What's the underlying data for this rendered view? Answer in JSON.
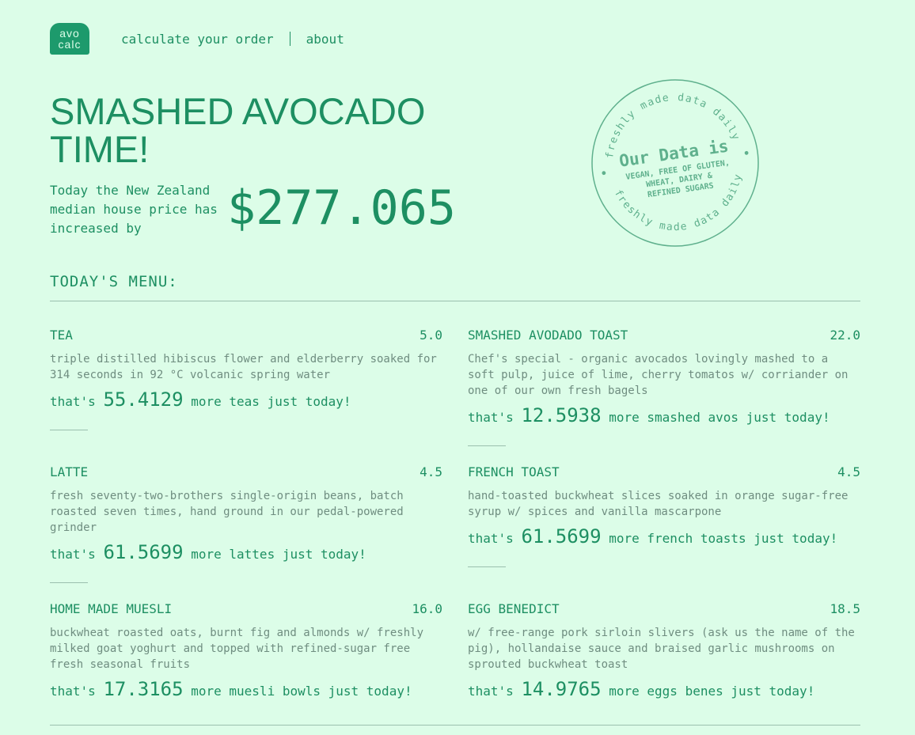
{
  "header": {
    "logo_line1": "avo",
    "logo_line2": "calc",
    "nav": [
      "calculate your order",
      "about"
    ]
  },
  "hero": {
    "title": "SMASHED AVOCADO TIME!",
    "description": "Today the New Zealand median house price has increased by",
    "price": "$277.065"
  },
  "stamp": {
    "top_ring": "freshly made data daily",
    "bottom_ring": "freshly made data daily",
    "headline": "Our Data is",
    "line1": "VEGAN, FREE OF GLUTEN,",
    "line2": "WHEAT, DAIRY &",
    "line3": "REFINED SUGARS"
  },
  "menu": {
    "heading": "TODAY'S MENU:",
    "items": [
      {
        "name": "TEA",
        "price": "5.0",
        "description": "triple distilled hibiscus flower and elderberry soaked for 314 seconds in 92 °C volcanic spring water",
        "prefix": "that's",
        "count": "55.4129",
        "suffix": "more teas just today!"
      },
      {
        "name": "SMASHED AVODADO TOAST",
        "price": "22.0",
        "description": "Chef's special - organic avocados lovingly mashed to a soft pulp, juice of lime, cherry tomatos w/ corriander on one of our own fresh bagels",
        "prefix": "that's",
        "count": "12.5938",
        "suffix": "more smashed avos just today!"
      },
      {
        "name": "LATTE",
        "price": "4.5",
        "description": "fresh seventy-two-brothers single-origin beans, batch roasted seven times, hand ground in our pedal-powered grinder",
        "prefix": "that's",
        "count": "61.5699",
        "suffix": "more lattes just today!"
      },
      {
        "name": "FRENCH TOAST",
        "price": "4.5",
        "description": "hand-toasted buckwheat slices soaked in orange sugar-free syrup w/ spices and vanilla mascarpone",
        "prefix": "that's",
        "count": "61.5699",
        "suffix": "more french toasts just today!"
      },
      {
        "name": "HOME MADE MUESLI",
        "price": "16.0",
        "description": "buckwheat roasted oats, burnt fig and almonds w/ freshly milked goat yoghurt and topped with refined-sugar free fresh seasonal fruits",
        "prefix": "that's",
        "count": "17.3165",
        "suffix": "more muesli bowls just today!"
      },
      {
        "name": "EGG BENEDICT",
        "price": "18.5",
        "description": "w/ free-range pork sirloin slivers (ask us the name of the pig), hollandaise sauce and braised garlic mushrooms on sprouted buckwheat toast",
        "prefix": "that's",
        "count": "14.9765",
        "suffix": "more eggs benes just today!"
      }
    ]
  },
  "colors": {
    "background": "#dcfde8",
    "primary": "#1d8f62",
    "muted_text": "#6f8d80",
    "rule": "#9bbfae"
  }
}
